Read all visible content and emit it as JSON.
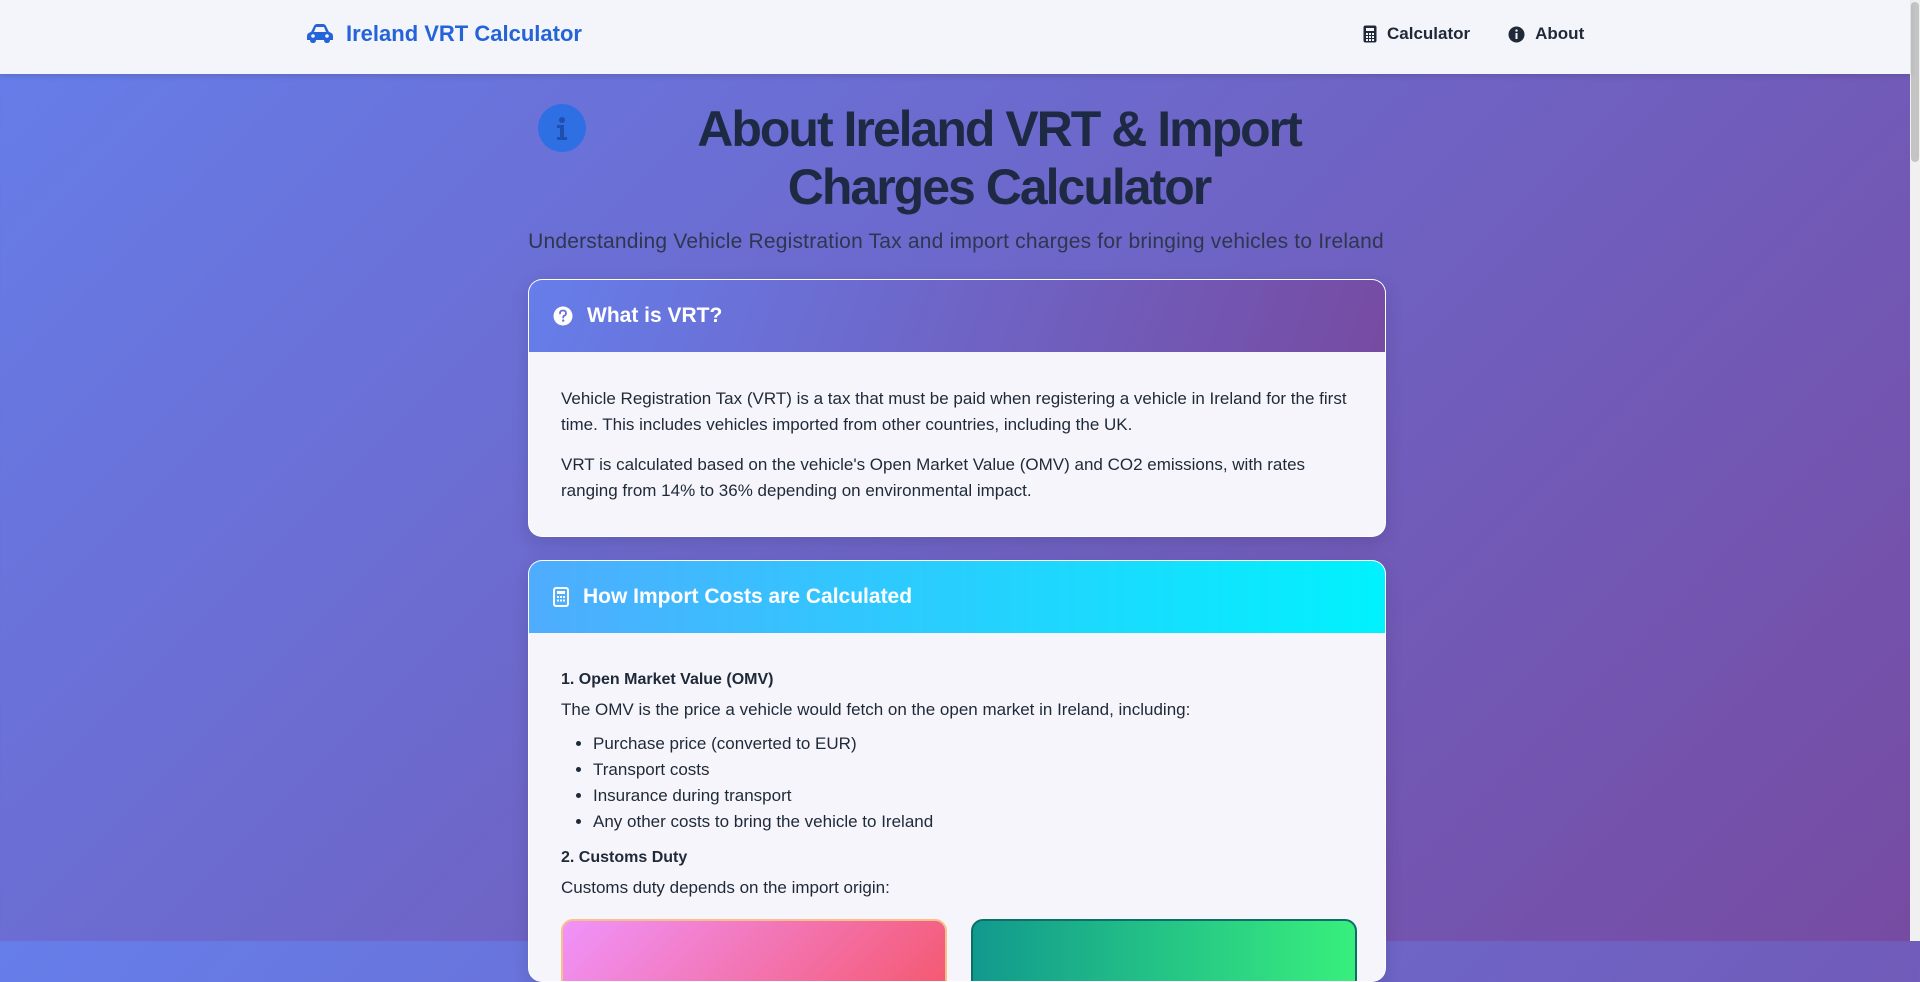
{
  "nav": {
    "brand": "Ireland VRT Calculator",
    "links": [
      {
        "label": "Calculator",
        "icon": "calculator-icon"
      },
      {
        "label": "About",
        "icon": "info-icon"
      }
    ]
  },
  "header": {
    "title": "About Ireland VRT & Import Charges Calculator",
    "subtitle": "Understanding Vehicle Registration Tax and import charges for bringing vehicles to Ireland"
  },
  "what_is_vrt": {
    "title": "What is VRT?",
    "icon": "question-circle-icon",
    "paragraphs": [
      "Vehicle Registration Tax (VRT) is a tax that must be paid when registering a vehicle in Ireland for the first time. This includes vehicles imported from other countries, including the UK.",
      "VRT is calculated based on the vehicle's Open Market Value (OMV) and CO2 emissions, with rates ranging from 14% to 36% depending on environmental impact."
    ]
  },
  "import_costs": {
    "title": "How Import Costs are Calculated",
    "icon": "calculator-icon",
    "omv_heading": "1. Open Market Value (OMV)",
    "omv_text": "The OMV is the price a vehicle would fetch on the open market in Ireland, including:",
    "omv_items": [
      "Purchase price (converted to EUR)",
      "Transport costs",
      "Insurance during transport",
      "Any other costs to bring the vehicle to Ireland"
    ],
    "customs_heading": "2. Customs Duty",
    "customs_text": "Customs duty depends on the import origin:"
  },
  "colors": {
    "brand": "#2463d8",
    "gradient_start": "#667eea",
    "gradient_end": "#764ba2",
    "cyan_start": "#4facfe",
    "cyan_end": "#00f2fe"
  }
}
